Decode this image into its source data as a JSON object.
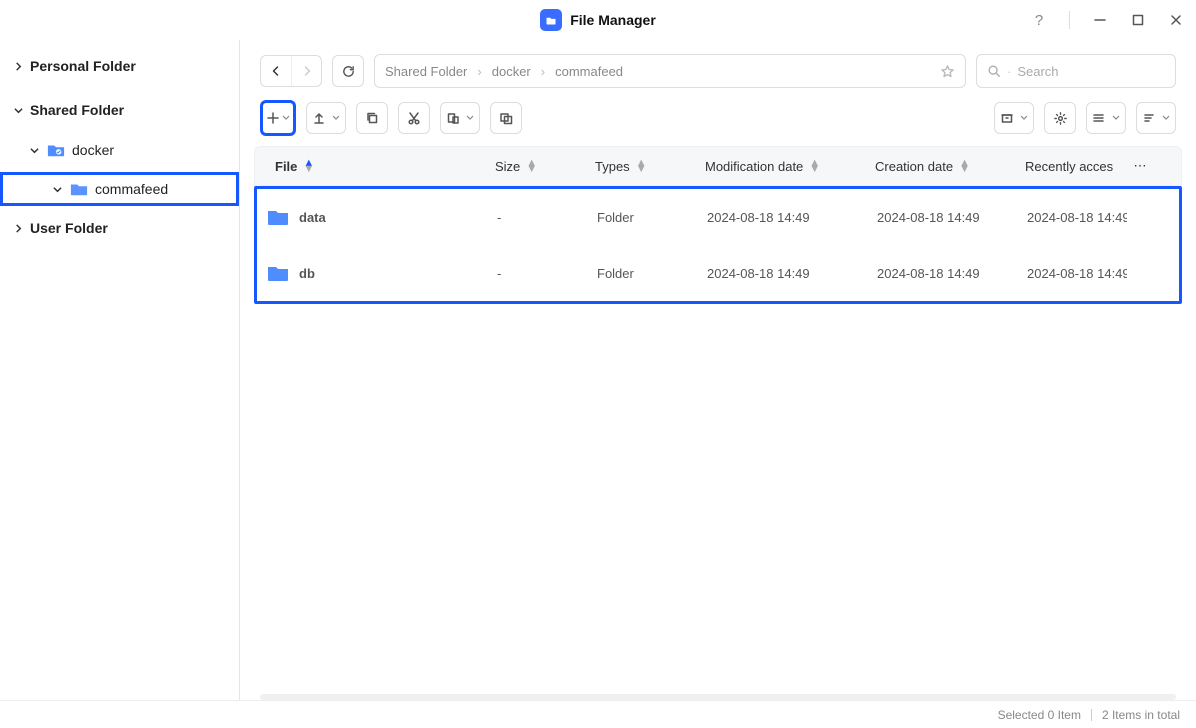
{
  "app": {
    "title": "File Manager"
  },
  "sidebar": {
    "items": [
      {
        "label": "Personal Folder",
        "expanded": false,
        "level": 0
      },
      {
        "label": "Shared Folder",
        "expanded": true,
        "level": 0
      },
      {
        "label": "docker",
        "expanded": true,
        "level": 1,
        "icon": "shared-folder"
      },
      {
        "label": "commafeed",
        "expanded": true,
        "level": 2,
        "icon": "folder",
        "selected": true
      },
      {
        "label": "User Folder",
        "expanded": false,
        "level": 0
      }
    ]
  },
  "breadcrumbs": {
    "segments": [
      "Shared Folder",
      "docker",
      "commafeed"
    ]
  },
  "search": {
    "placeholder": "Search"
  },
  "columns": {
    "file": "File",
    "size": "Size",
    "types": "Types",
    "modification": "Modification date",
    "creation": "Creation date",
    "recent": "Recently acces"
  },
  "rows": [
    {
      "name": "data",
      "size": "-",
      "type": "Folder",
      "modified": "2024-08-18 14:49",
      "created": "2024-08-18 14:49",
      "accessed": "2024-08-18 14:49"
    },
    {
      "name": "db",
      "size": "-",
      "type": "Folder",
      "modified": "2024-08-18 14:49",
      "created": "2024-08-18 14:49",
      "accessed": "2024-08-18 14:49"
    }
  ],
  "status": {
    "selected": "Selected 0 Item",
    "total": "2 Items in total"
  }
}
